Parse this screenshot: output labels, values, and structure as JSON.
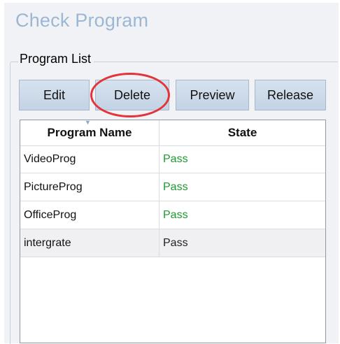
{
  "window": {
    "title": "Check Program"
  },
  "group": {
    "label": "Program List"
  },
  "toolbar": {
    "edit_label": "Edit",
    "delete_label": "Delete",
    "preview_label": "Preview",
    "release_label": "Release",
    "highlighted_button": "Delete",
    "highlight_color": "#e2343a"
  },
  "table": {
    "columns": [
      "Program Name",
      "State"
    ],
    "rows": [
      {
        "name": "VideoProg",
        "state": "Pass",
        "state_color": "#1e9a2e",
        "selected": false
      },
      {
        "name": "PictureProg",
        "state": "Pass",
        "state_color": "#1e9a2e",
        "selected": false
      },
      {
        "name": "OfficeProg",
        "state": "Pass",
        "state_color": "#1e9a2e",
        "selected": false
      },
      {
        "name": "intergrate",
        "state": "Pass",
        "state_color": "#222222",
        "selected": true
      }
    ]
  },
  "colors": {
    "title": "#9cb7d4",
    "panel_background": "#f0f2f6",
    "button_gradient_top": "#d6e2ee",
    "button_gradient_bottom": "#c3d3e5"
  }
}
